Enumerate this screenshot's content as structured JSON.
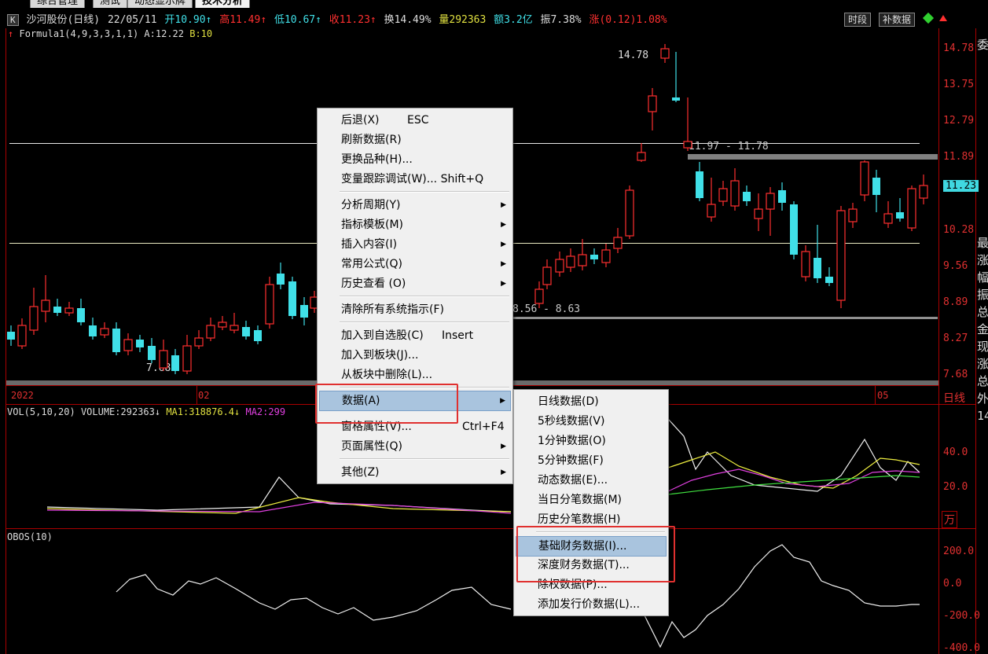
{
  "tabs": [
    "综合管理",
    "测试",
    "动态显示牌",
    "技术分析"
  ],
  "header": {
    "badge": "K",
    "name": "沙河股份(日线)",
    "date": "22/05/11",
    "open": "开10.90↑",
    "high": "高11.49↑",
    "low": "低10.67↑",
    "close": "收11.23↑",
    "turnover": "换14.49%",
    "volume": "量292363",
    "amount": "额3.2亿",
    "amplitude": "振7.38%",
    "change": "涨(0.12)1.08%",
    "btn_period": "时段",
    "btn_data": "补数据"
  },
  "formula": {
    "arrow": "↑",
    "name": "Formula1(4,9,3,3,1,1)",
    "a": "A:12.22",
    "b": "B:10"
  },
  "price_axis": [
    "14.78",
    "13.75",
    "12.79",
    "11.89",
    "11.23",
    "10.28",
    "9.56",
    "8.89",
    "8.27",
    "7.68"
  ],
  "annotations": {
    "peak": "14.78",
    "low": "7.68",
    "range1": "11.97 - 11.78",
    "range2": "8.56 - 8.63"
  },
  "date_axis": [
    "2022",
    "02",
    "05",
    "日线"
  ],
  "vol": {
    "label": "VOL(5,10,20)",
    "volume": "VOLUME:292363↓",
    "ma1": "MA1:318876.4↓",
    "ma2": "MA2:299",
    "ticks": [
      "40.0",
      "20.0"
    ],
    "unit": "万"
  },
  "obos": {
    "label": "OBOS(10)",
    "ticks": [
      "200.0",
      "0.0",
      "-200.0",
      "-400.0"
    ]
  },
  "right_panel": [
    "委",
    "最",
    "涨",
    "幅",
    "振",
    "总",
    "金",
    "现",
    "涨",
    "总",
    "外",
    "14"
  ],
  "context_menu": {
    "items": [
      {
        "label": "后退(X)",
        "shortcut": "ESC"
      },
      {
        "label": "刷新数据(R)"
      },
      {
        "label": "更换品种(H)..."
      },
      {
        "label": "变量跟踪调试(W)... Shift+Q"
      },
      {
        "label": "分析周期(Y)",
        "sub": true
      },
      {
        "label": "指标模板(M)",
        "sub": true
      },
      {
        "label": "插入内容(I)",
        "sub": true
      },
      {
        "label": "常用公式(Q)",
        "sub": true
      },
      {
        "label": "历史查看 (O)",
        "sub": true
      },
      {
        "label": "清除所有系统指示(F)"
      },
      {
        "label": "加入到自选股(C)",
        "shortcut": "Insert"
      },
      {
        "label": "加入到板块(J)..."
      },
      {
        "label": "从板块中删除(L)..."
      },
      {
        "label": "数据(A)",
        "sub": true
      },
      {
        "label": "窗格属性(V)...",
        "shortcut": "Ctrl+F4"
      },
      {
        "label": "页面属性(Q)",
        "sub": true
      },
      {
        "label": "其他(Z)",
        "sub": true
      }
    ]
  },
  "data_submenu": {
    "items": [
      "日线数据(D)",
      "5秒线数据(V)",
      "1分钟数据(O)",
      "5分钟数据(F)",
      "动态数据(E)...",
      "当日分笔数据(M)",
      "历史分笔数据(H)",
      "基础财务数据(I)...",
      "深度财务数据(T)...",
      "除权数据(P)...",
      "添加发行价数据(L)..."
    ]
  },
  "colors": {
    "up": "#ff3030",
    "down": "#40e0e8",
    "axis": "#a00000",
    "highlight": "#a9c4de",
    "callout": "#e0302f"
  }
}
